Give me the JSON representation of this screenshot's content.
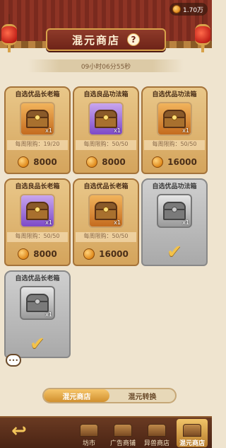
{
  "header": {
    "title": "混元商店",
    "help": "?",
    "currency": "1.70万",
    "timer": "09小时06分55秒"
  },
  "items": [
    {
      "name": "自选优品长老箱",
      "qty": "x1",
      "limit": "每周限购：19/20",
      "price": "8000",
      "color": "orange",
      "sold_out": false
    },
    {
      "name": "自选良品功法箱",
      "qty": "x1",
      "limit": "每周限购：50/50",
      "price": "8000",
      "color": "purple",
      "sold_out": false
    },
    {
      "name": "自选优品功法箱",
      "qty": "x1",
      "limit": "每周限购：50/50",
      "price": "16000",
      "color": "orange",
      "sold_out": false
    },
    {
      "name": "自选良品长老箱",
      "qty": "x1",
      "limit": "每周限购：50/50",
      "price": "8000",
      "color": "purple",
      "sold_out": false
    },
    {
      "name": "自选优品长老箱",
      "qty": "x1",
      "limit": "每周限购：50/50",
      "price": "16000",
      "color": "orange",
      "sold_out": false
    },
    {
      "name": "自选优品功法箱",
      "qty": "x1",
      "limit": "",
      "price": "",
      "color": "gray",
      "sold_out": true
    },
    {
      "name": "自选优品长老箱",
      "qty": "x1",
      "limit": "",
      "price": "",
      "color": "gray",
      "sold_out": true
    }
  ],
  "chat_icon": "chat-bubble-icon",
  "chat_text": "•••",
  "tabs": {
    "shop": "混元商店",
    "exchange": "混元转换"
  },
  "nav": {
    "back_icon": "back-arrow-icon",
    "back_glyph": "↩",
    "check_glyph": "✔",
    "items": [
      {
        "label": "坊市",
        "icon": "market-icon"
      },
      {
        "label": "广告商铺",
        "icon": "ad-shop-icon"
      },
      {
        "label": "异兽商店",
        "icon": "beast-shop-icon"
      },
      {
        "label": "混元商店",
        "icon": "hunyuan-shop-icon"
      }
    ]
  }
}
